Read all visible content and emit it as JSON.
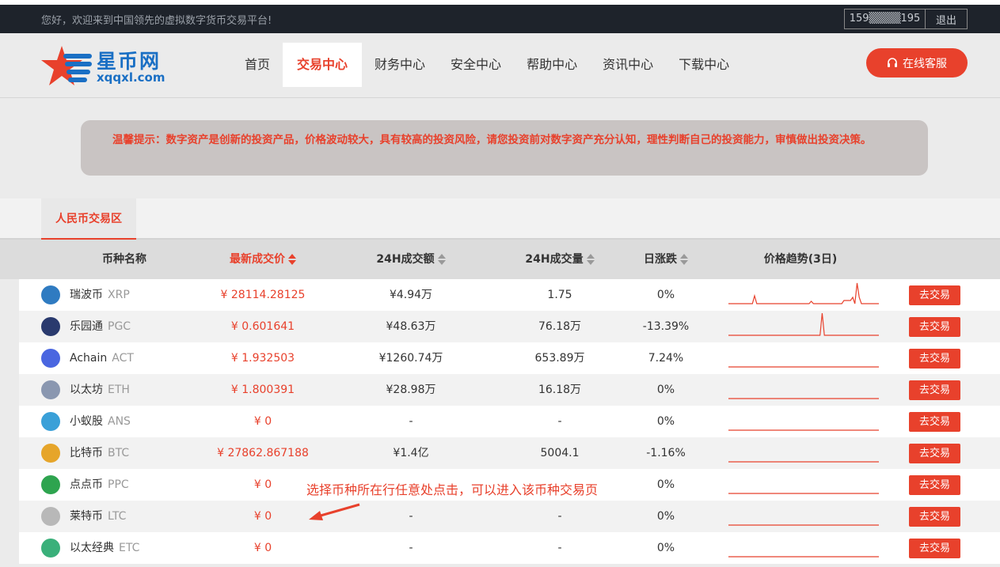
{
  "topbar": {
    "welcome": "您好，欢迎来到中国领先的虚拟数字货币交易平台!",
    "phone": "159▒▒▒▒195",
    "logout": "退出"
  },
  "logo": {
    "brand": "星币网",
    "domain": "xqqxl.com"
  },
  "nav": {
    "items": [
      "首页",
      "交易中心",
      "财务中心",
      "安全中心",
      "帮助中心",
      "资讯中心",
      "下载中心"
    ],
    "active": "交易中心"
  },
  "service": {
    "label": "在线客服",
    "icon": "headset-icon"
  },
  "notice": "温馨提示：数字资产是创新的投资产品，价格波动较大，具有较高的投资风险，请您投资前对数字资产充分认知，理性判断自己的投资能力，审慎做出投资决策。",
  "tab": {
    "label": "人民币交易区"
  },
  "table": {
    "headers": {
      "name": "币种名称",
      "price": "最新成交价",
      "amount": "24H成交额",
      "volume": "24H成交量",
      "change": "日涨跌",
      "trend": "价格趋势(3日)"
    },
    "trade_label": "去交易",
    "rows": [
      {
        "name": "瑞波币",
        "code": "XRP",
        "price": "¥ 28114.28125",
        "amount": "¥4.94万",
        "volume": "1.75",
        "change": "0%",
        "icon": "xrp-icon",
        "color": "#2f7bc1",
        "trend": [
          0,
          0,
          0,
          0,
          0,
          0,
          0,
          0,
          0,
          0,
          0,
          0,
          10,
          0,
          0,
          0,
          0,
          0,
          0,
          0,
          0,
          0,
          0,
          0,
          0,
          0,
          0,
          0,
          0,
          0,
          0,
          0,
          0,
          0,
          0,
          0,
          0,
          0,
          3,
          0,
          0,
          0,
          0,
          0,
          0,
          0,
          0,
          0,
          0,
          0,
          0,
          0,
          0,
          4,
          4,
          4,
          4,
          8,
          0,
          26,
          8,
          0,
          0,
          0,
          0,
          0,
          0,
          0,
          0,
          0
        ]
      },
      {
        "name": "乐园通",
        "code": "PGC",
        "price": "¥ 0.601641",
        "amount": "¥48.63万",
        "volume": "76.18万",
        "change": "-13.39%",
        "icon": "pgc-icon",
        "color": "#2a3a6e",
        "trend": [
          0,
          0,
          0,
          0,
          0,
          0,
          0,
          0,
          0,
          0,
          0,
          0,
          0,
          0,
          0,
          0,
          0,
          0,
          0,
          0,
          0,
          0,
          0,
          0,
          0,
          0,
          0,
          0,
          0,
          0,
          0,
          0,
          0,
          0,
          0,
          0,
          0,
          0,
          0,
          0,
          0,
          0,
          0,
          28,
          0,
          0,
          0,
          0,
          0,
          0,
          0,
          0,
          0,
          0,
          0,
          0,
          0,
          0,
          0,
          0,
          0,
          0,
          0,
          0,
          0,
          0,
          0,
          0,
          0,
          0
        ]
      },
      {
        "name": "Achain",
        "code": "ACT",
        "price": "¥ 1.932503",
        "amount": "¥1260.74万",
        "volume": "653.89万",
        "change": "7.24%",
        "icon": "achain-icon",
        "color": "#4a66e0",
        "trend": [
          0,
          0
        ]
      },
      {
        "name": "以太坊",
        "code": "ETH",
        "price": "¥ 1.800391",
        "amount": "¥28.98万",
        "volume": "16.18万",
        "change": "0%",
        "icon": "eth-icon",
        "color": "#8a97b0",
        "trend": [
          0,
          0
        ]
      },
      {
        "name": "小蚁股",
        "code": "ANS",
        "price": "¥ 0",
        "amount": "-",
        "volume": "-",
        "change": "0%",
        "icon": "ans-icon",
        "color": "#3aa0d8",
        "trend": [
          0,
          0
        ]
      },
      {
        "name": "比特币",
        "code": "BTC",
        "price": "¥ 27862.867188",
        "amount": "¥1.4亿",
        "volume": "5004.1",
        "change": "-1.16%",
        "icon": "btc-icon",
        "color": "#e6a52a",
        "trend": [
          0,
          0
        ]
      },
      {
        "name": "点点币",
        "code": "PPC",
        "price": "¥ 0",
        "amount": "",
        "volume": "",
        "change": "0%",
        "icon": "ppc-icon",
        "color": "#2ea44f",
        "trend": [
          0,
          0
        ]
      },
      {
        "name": "莱特币",
        "code": "LTC",
        "price": "¥ 0",
        "amount": "-",
        "volume": "-",
        "change": "0%",
        "icon": "ltc-icon",
        "color": "#b8b8b8",
        "trend": [
          0,
          0
        ]
      },
      {
        "name": "以太经典",
        "code": "ETC",
        "price": "¥ 0",
        "amount": "-",
        "volume": "-",
        "change": "0%",
        "icon": "etc-icon",
        "color": "#3ab07a",
        "trend": [
          0,
          0
        ]
      }
    ]
  },
  "annotation": "选择币种所在行任意处点击，可以进入该币种交易页",
  "colors": {
    "accent": "#e8412c",
    "topbar": "#1e232b",
    "brand": "#1a6fc4"
  }
}
